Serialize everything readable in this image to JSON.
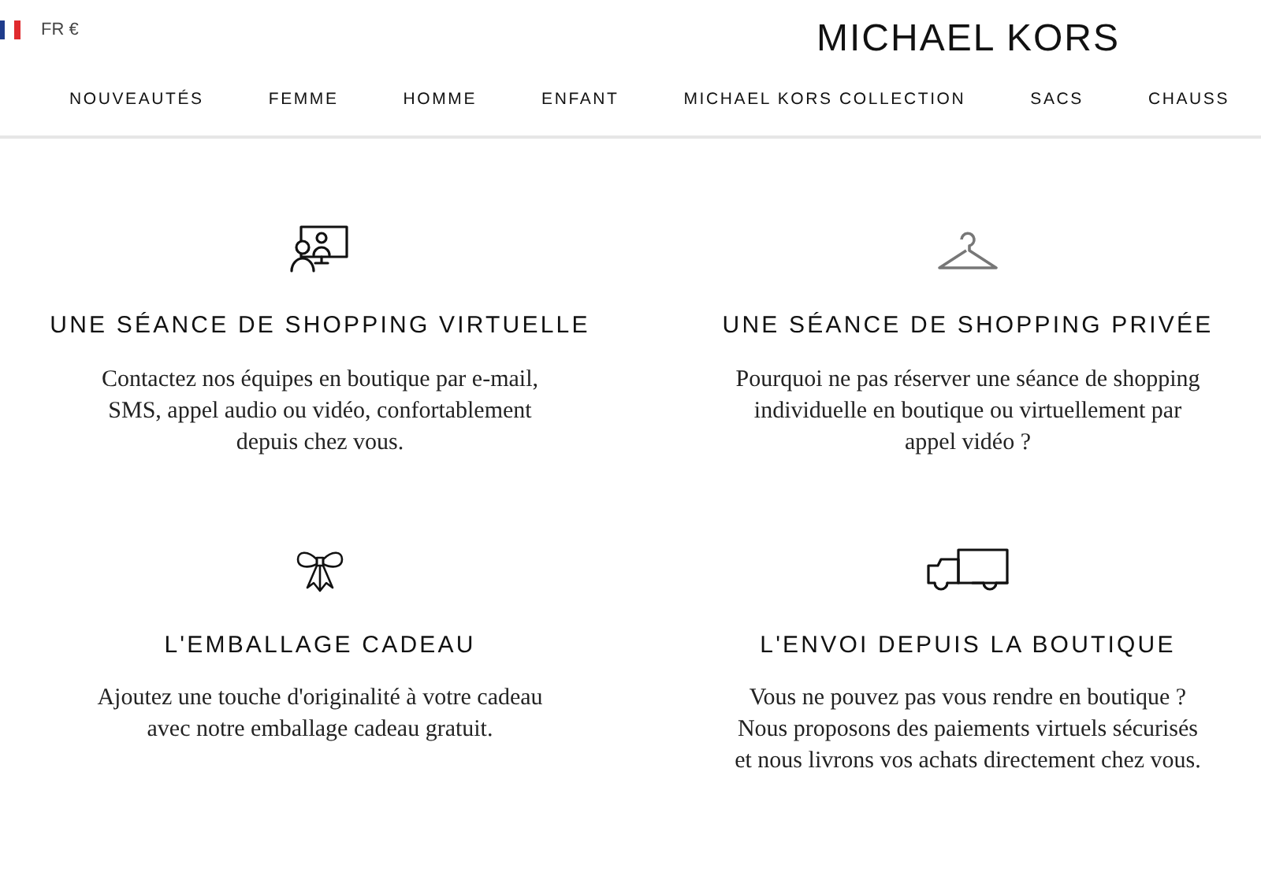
{
  "header": {
    "locale": "FR €",
    "logo": "MICHAEL KORS"
  },
  "nav": [
    {
      "label": "NOUVEAUTÉS"
    },
    {
      "label": "FEMME"
    },
    {
      "label": "HOMME"
    },
    {
      "label": "ENFANT"
    },
    {
      "label": "MICHAEL KORS COLLECTION"
    },
    {
      "label": "SACS"
    },
    {
      "label": "CHAUSS"
    }
  ],
  "services": [
    {
      "kind": "video",
      "title": "UNE SÉANCE DE SHOPPING VIRTUELLE",
      "text": [
        "Contactez nos équipes en boutique par e-mail,",
        "SMS, appel audio ou vidéo, confortablement",
        "depuis chez vous."
      ]
    },
    {
      "kind": "hanger",
      "title": "UNE SÉANCE DE SHOPPING PRIVÉE",
      "text": [
        "Pourquoi ne pas réserver une séance de shopping",
        "individuelle en boutique ou virtuellement par",
        "appel vidéo ?"
      ]
    },
    {
      "kind": "bow",
      "title": "L'EMBALLAGE CADEAU",
      "text": [
        "Ajoutez une touche d'originalité à votre cadeau",
        "avec notre emballage cadeau gratuit."
      ]
    },
    {
      "kind": "truck",
      "title": "L'ENVOI DEPUIS LA BOUTIQUE",
      "text": [
        "Vous ne pouvez pas vous rendre en boutique ?",
        "Nous proposons des paiements virtuels sécurisés",
        "et nous livrons vos achats directement chez vous."
      ]
    }
  ]
}
